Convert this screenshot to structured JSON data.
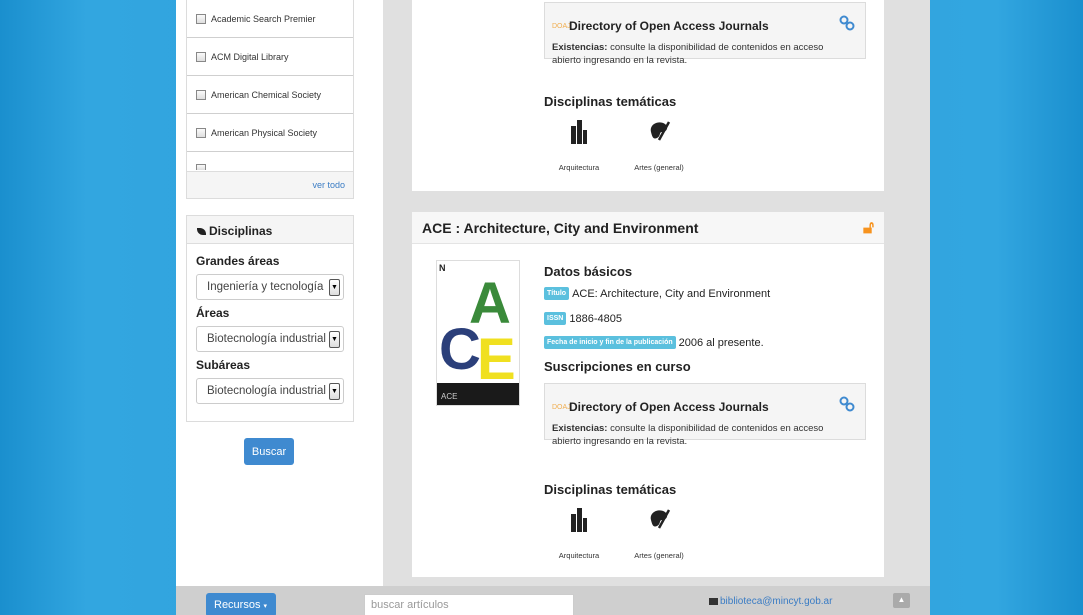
{
  "sidebar": {
    "resources": [
      {
        "label": "Academic Search Premier"
      },
      {
        "label": "ACM Digital Library"
      },
      {
        "label": "American Chemical Society"
      },
      {
        "label": "American Physical Society"
      }
    ],
    "see_all": "ver todo",
    "disciplines": {
      "title": "Disciplinas",
      "grandes_label": "Grandes áreas",
      "grandes_value": "Ingeniería y tecnología",
      "areas_label": "Áreas",
      "areas_value": "Biotecnología industrial",
      "subareas_label": "Subáreas",
      "subareas_value": "Biotecnología industrial"
    },
    "search_button": "Buscar"
  },
  "journals": [
    {
      "subscription": {
        "tag": "DOAJ",
        "name": "Directory of Open Access Journals",
        "existencias_label": "Existencias:",
        "existencias_text": "consulte la disponibilidad de contenidos en acceso abierto ingresando en la revista."
      },
      "disciplines_title": "Disciplinas temáticas",
      "disciplines": [
        {
          "label": "Arquitectura",
          "icon": "building-icon"
        },
        {
          "label": "Artes (general)",
          "icon": "palette-icon"
        }
      ]
    },
    {
      "title": "ACE : Architecture, City and Environment",
      "cover": {
        "band_text": "ACE",
        "top_text": "N"
      },
      "basic_title": "Datos básicos",
      "fields": {
        "titulo_badge": "Título",
        "titulo_value": "ACE: Architecture, City and Environment",
        "issn_badge": "ISSN",
        "issn_value": "1886-4805",
        "fecha_badge": "Fecha de inicio y fin de la publicación",
        "fecha_value": "2006 al presente."
      },
      "subs_title": "Suscripciones en curso",
      "subscription": {
        "tag": "DOAJ",
        "name": "Directory of Open Access Journals",
        "existencias_label": "Existencias:",
        "existencias_text": "consulte la disponibilidad de contenidos en acceso abierto ingresando en la revista."
      },
      "disciplines_title": "Disciplinas temáticas",
      "disciplines": [
        {
          "label": "Arquitectura",
          "icon": "building-icon"
        },
        {
          "label": "Artes (general)",
          "icon": "palette-icon"
        }
      ]
    }
  ],
  "footer": {
    "recursos": "Recursos",
    "search_placeholder": "buscar artículos",
    "email": "biblioteca@mincyt.gob.ar"
  },
  "colors": {
    "accent": "#3f8ad0",
    "open_access": "#f7931e",
    "badge": "#5bc0de"
  }
}
